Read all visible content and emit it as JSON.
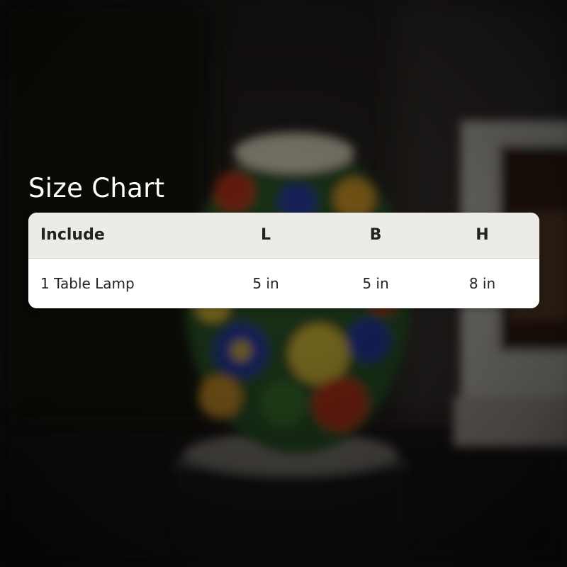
{
  "heading": "Size Chart",
  "table": {
    "headers": [
      "Include",
      "L",
      "B",
      "H"
    ],
    "rows": [
      [
        "1 Table Lamp",
        "5 in",
        "5 in",
        "8 in"
      ]
    ]
  },
  "colors": {
    "header_row_bg": "#ecebe6",
    "body_row_bg": "#ffffff",
    "text": "#222222",
    "heading_text": "#ffffff"
  },
  "background": {
    "description_icon": "blurred-floral-table-lamp-photo"
  }
}
